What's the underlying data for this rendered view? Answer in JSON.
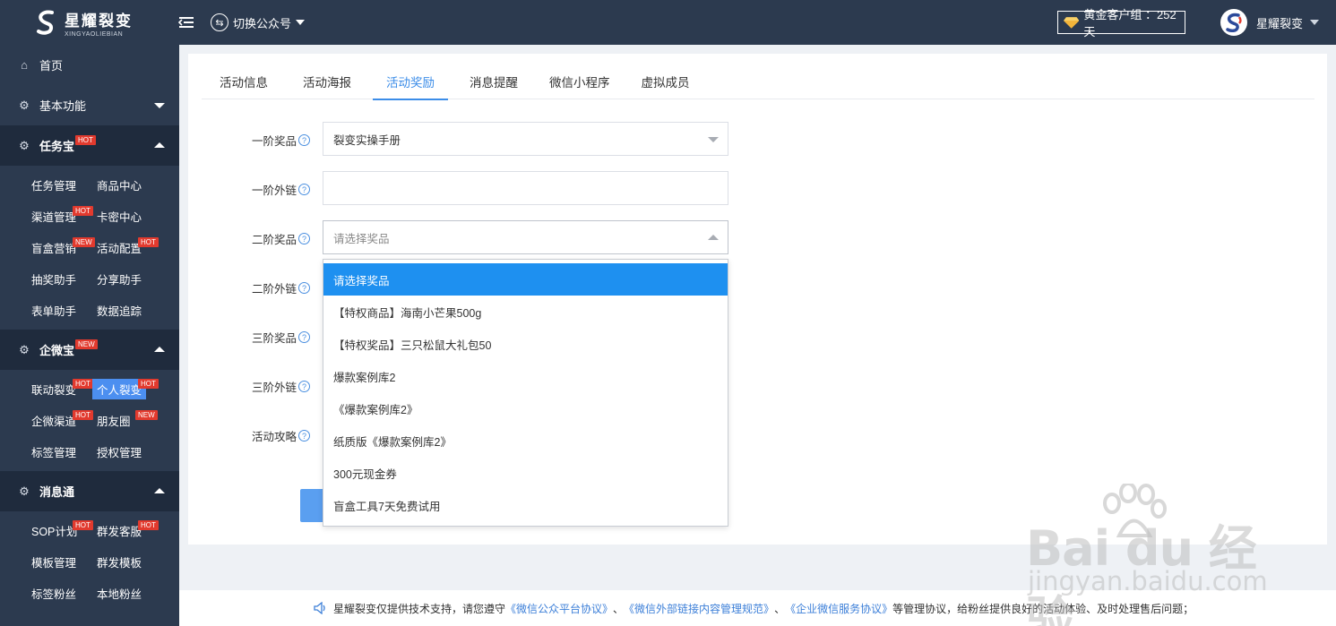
{
  "header": {
    "logo_cn": "星耀裂变",
    "logo_en": "XINGYAOLIEBIAN",
    "switch_label": "切换公众号",
    "badge": "黄金客户组 ：252天",
    "user_name": "星耀裂变"
  },
  "sidebar": {
    "home": "首页",
    "basic": "基本功能",
    "group_renwu": {
      "label": "任务宝",
      "tag": "HOT"
    },
    "renwu_items": [
      {
        "label": "任务管理",
        "tag": ""
      },
      {
        "label": "商品中心",
        "tag": ""
      },
      {
        "label": "渠道管理",
        "tag": "HOT"
      },
      {
        "label": "卡密中心",
        "tag": ""
      },
      {
        "label": "盲盒营销",
        "tag": "NEW"
      },
      {
        "label": "活动配置",
        "tag": "HOT"
      },
      {
        "label": "抽奖助手",
        "tag": ""
      },
      {
        "label": "分享助手",
        "tag": ""
      },
      {
        "label": "表单助手",
        "tag": ""
      },
      {
        "label": "数据追踪",
        "tag": ""
      }
    ],
    "group_qiwei": {
      "label": "企微宝",
      "tag": "NEW"
    },
    "qiwei_items": [
      {
        "label": "联动裂变",
        "tag": "HOT"
      },
      {
        "label": "个人裂变",
        "tag": "HOT"
      },
      {
        "label": "企微渠道",
        "tag": "HOT"
      },
      {
        "label": "朋友圈",
        "tag": "NEW"
      },
      {
        "label": "标签管理",
        "tag": ""
      },
      {
        "label": "授权管理",
        "tag": ""
      }
    ],
    "group_xiaoxi": {
      "label": "消息通"
    },
    "xiaoxi_items": [
      {
        "label": "SOP计划",
        "tag": "HOT"
      },
      {
        "label": "群发客服",
        "tag": "HOT"
      },
      {
        "label": "模板管理",
        "tag": ""
      },
      {
        "label": "群发模板",
        "tag": ""
      },
      {
        "label": "标签粉丝",
        "tag": ""
      },
      {
        "label": "本地粉丝",
        "tag": ""
      }
    ]
  },
  "tabs": [
    "活动信息",
    "活动海报",
    "活动奖励",
    "消息提醒",
    "微信小程序",
    "虚拟成员"
  ],
  "form": {
    "tier1_prize_label": "一阶奖品",
    "tier1_prize_value": "裂变实操手册",
    "tier1_link_label": "一阶外链",
    "tier1_link_value": "",
    "tier2_prize_label": "二阶奖品",
    "tier2_prize_placeholder": "请选择奖品",
    "tier2_link_label": "二阶外链",
    "tier3_prize_label": "三阶奖品",
    "tier3_link_label": "三阶外链",
    "strategy_label": "活动攻略"
  },
  "dropdown_options": [
    "请选择奖品",
    "【特权商品】海南小芒果500g",
    "【特权奖品】三只松鼠大礼包50",
    "爆款案例库2",
    "《爆款案例库2》",
    "纸质版《爆款案例库2》",
    "300元现金券",
    "盲盒工具7天免费试用"
  ],
  "footer": {
    "prefix": "星耀裂变仅提供技术支持，请您遵守",
    "link1": "《微信公众平台协议》",
    "sep1": "、",
    "link2": "《微信外部链接内容管理规范》",
    "sep2": "、",
    "link3": "《企业微信服务协议》",
    "suffix": "等管理协议，给粉丝提供良好的活动体验、及时处理售后问题；"
  },
  "watermark": {
    "main": "Bai du 经验",
    "sub": "jingyan.baidu.com"
  },
  "colors": {
    "sidebar_bg": "#2c3a4f",
    "accent": "#3c8de8",
    "selected_option": "#1e90f0",
    "hot_tag": "#e23a2e"
  }
}
